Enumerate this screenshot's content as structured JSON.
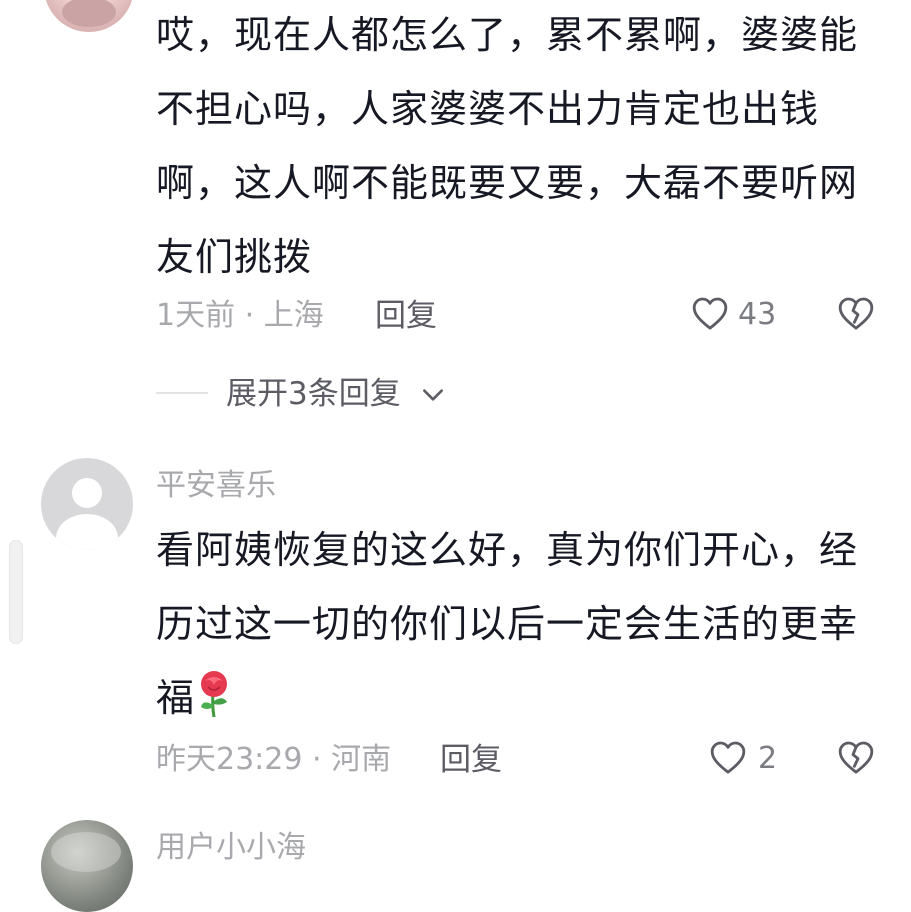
{
  "comments": [
    {
      "text_lines": [
        "哎，现在人都怎么了，累不累啊，婆婆能",
        "不担心吗，人家婆婆不出力肯定也出钱",
        "啊，这人啊不能既要又要，大磊不要听网",
        "友们挑拨"
      ],
      "meta": "1天前 · 上海",
      "reply_label": "回复",
      "likes": "43",
      "expand_replies": "展开3条回复"
    },
    {
      "username": "平安喜乐",
      "text_lines": [
        "看阿姨恢复的这么好，真为你们开心，经",
        "历过这一切的你们以后一定会生活的更幸",
        "福"
      ],
      "emoji": "🌹",
      "meta": "昨天23:29 · 河南",
      "reply_label": "回复",
      "likes": "2"
    },
    {
      "username": "用户小小海"
    }
  ],
  "icons": {
    "like": "heart-outline-icon",
    "dislike": "broken-heart-icon",
    "expand": "chevron-down-icon"
  },
  "colors": {
    "text": "#161823",
    "meta": "#a8a9ad",
    "action": "#5c5d64"
  }
}
